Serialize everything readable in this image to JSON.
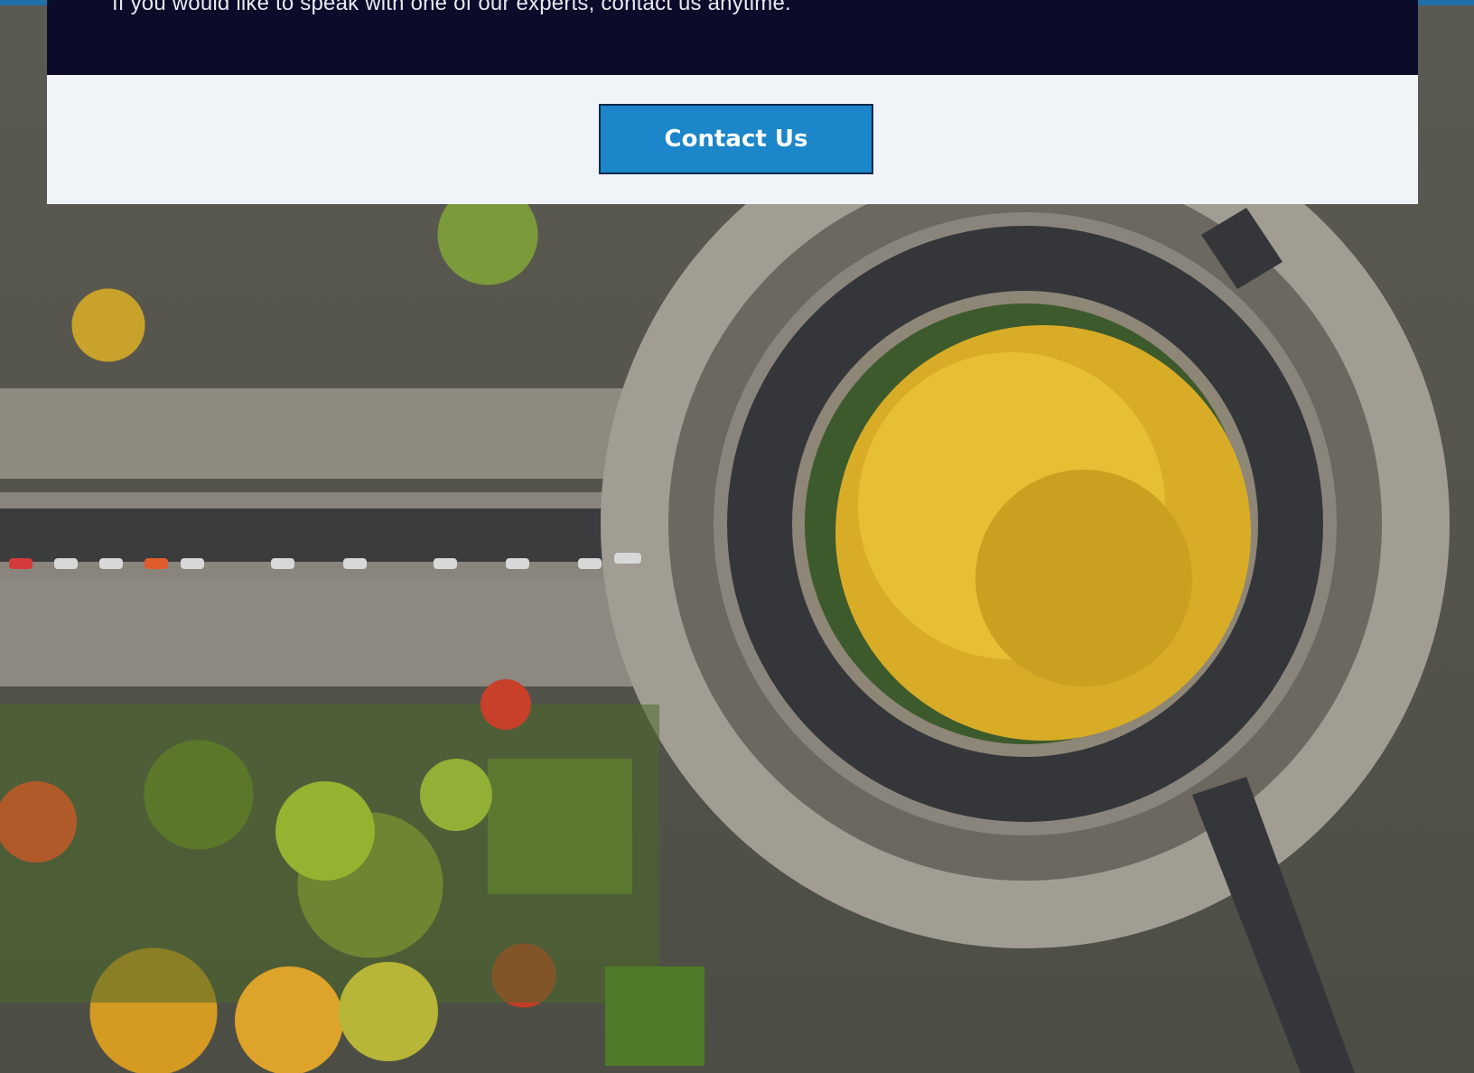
{
  "banner": {
    "message": "If you would like to speak with one of our experts, contact us anytime."
  },
  "cta": {
    "label": "Contact Us"
  },
  "colors": {
    "banner_bg": "#0b0c2a",
    "panel_bg": "#f0f4f8",
    "button_bg": "#1b86c9"
  }
}
